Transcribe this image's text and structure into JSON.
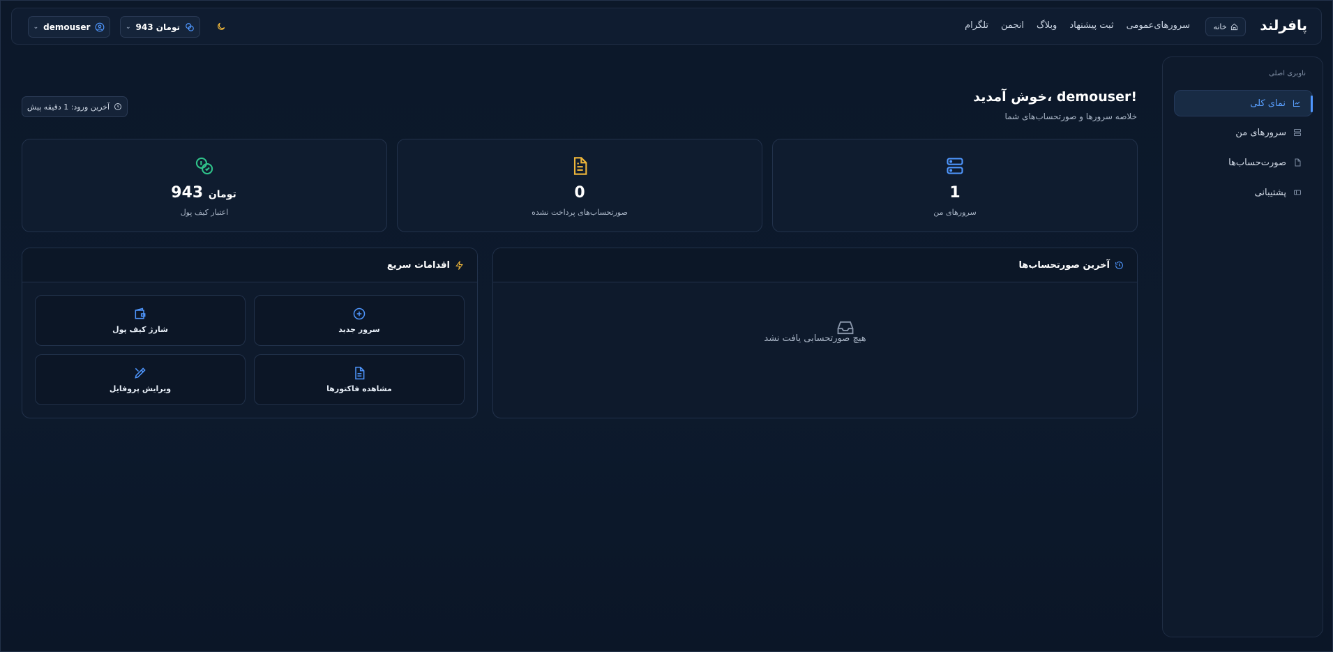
{
  "header": {
    "brand": "پافرلند",
    "home_label": "خانه",
    "nav": [
      "سرورهای‌عمومی",
      "ثبت پیشنهاد",
      "وبلاگ",
      "انجمن",
      "تلگرام"
    ],
    "wallet_pill": "943 تومان",
    "username": "demouser",
    "icons": {
      "home": "home-icon",
      "theme": "moon-icon",
      "wallet": "coins-icon",
      "user": "user-circle-icon",
      "dropdown": "chevron-down-icon"
    }
  },
  "sidebar": {
    "title": "ناوبری اصلی",
    "items": [
      {
        "label": "نمای کلی",
        "icon": "chart-icon",
        "active": true
      },
      {
        "label": "سرورهای من",
        "icon": "server-icon",
        "active": false
      },
      {
        "label": "صورت‌حساب‌ها",
        "icon": "file-icon",
        "active": false
      },
      {
        "label": "پشتیبانی",
        "icon": "ticket-icon",
        "active": false
      }
    ]
  },
  "welcome": {
    "title": "خوش آمدید، demouser!",
    "subtitle": "خلاصه سرورها و صورتحساب‌های شما",
    "last_login": "آخرین ورود: 1 دقیقه پیش"
  },
  "stats": [
    {
      "value": "1",
      "unit": "",
      "label": "سرورهای من",
      "icon": "server-icon",
      "color": "#4f97ff"
    },
    {
      "value": "0",
      "unit": "",
      "label": "صورتحساب‌های پرداخت نشده",
      "icon": "file-text-icon",
      "color": "#f0b73a"
    },
    {
      "value": "943",
      "unit": "تومان",
      "label": "اعتبار کیف پول",
      "icon": "coins-icon",
      "color": "#2fc38a"
    }
  ],
  "invoices_panel": {
    "title": "آخرین صورتحساب‌ها",
    "empty_message": "هیچ صورتحسابی یافت نشد"
  },
  "quick_actions": {
    "title": "اقدامات سریع",
    "items": [
      {
        "label": "سرور جدید",
        "icon": "plus-circle-icon"
      },
      {
        "label": "شارژ کیف پول",
        "icon": "wallet-icon"
      },
      {
        "label": "مشاهده فاکتورها",
        "icon": "file-text-icon"
      },
      {
        "label": "ویرایش پروفایل",
        "icon": "edit-icon"
      }
    ]
  },
  "colors": {
    "accent": "#4f97ff",
    "warning": "#f0b73a",
    "success": "#2fc38a",
    "background": "#0c1829"
  }
}
